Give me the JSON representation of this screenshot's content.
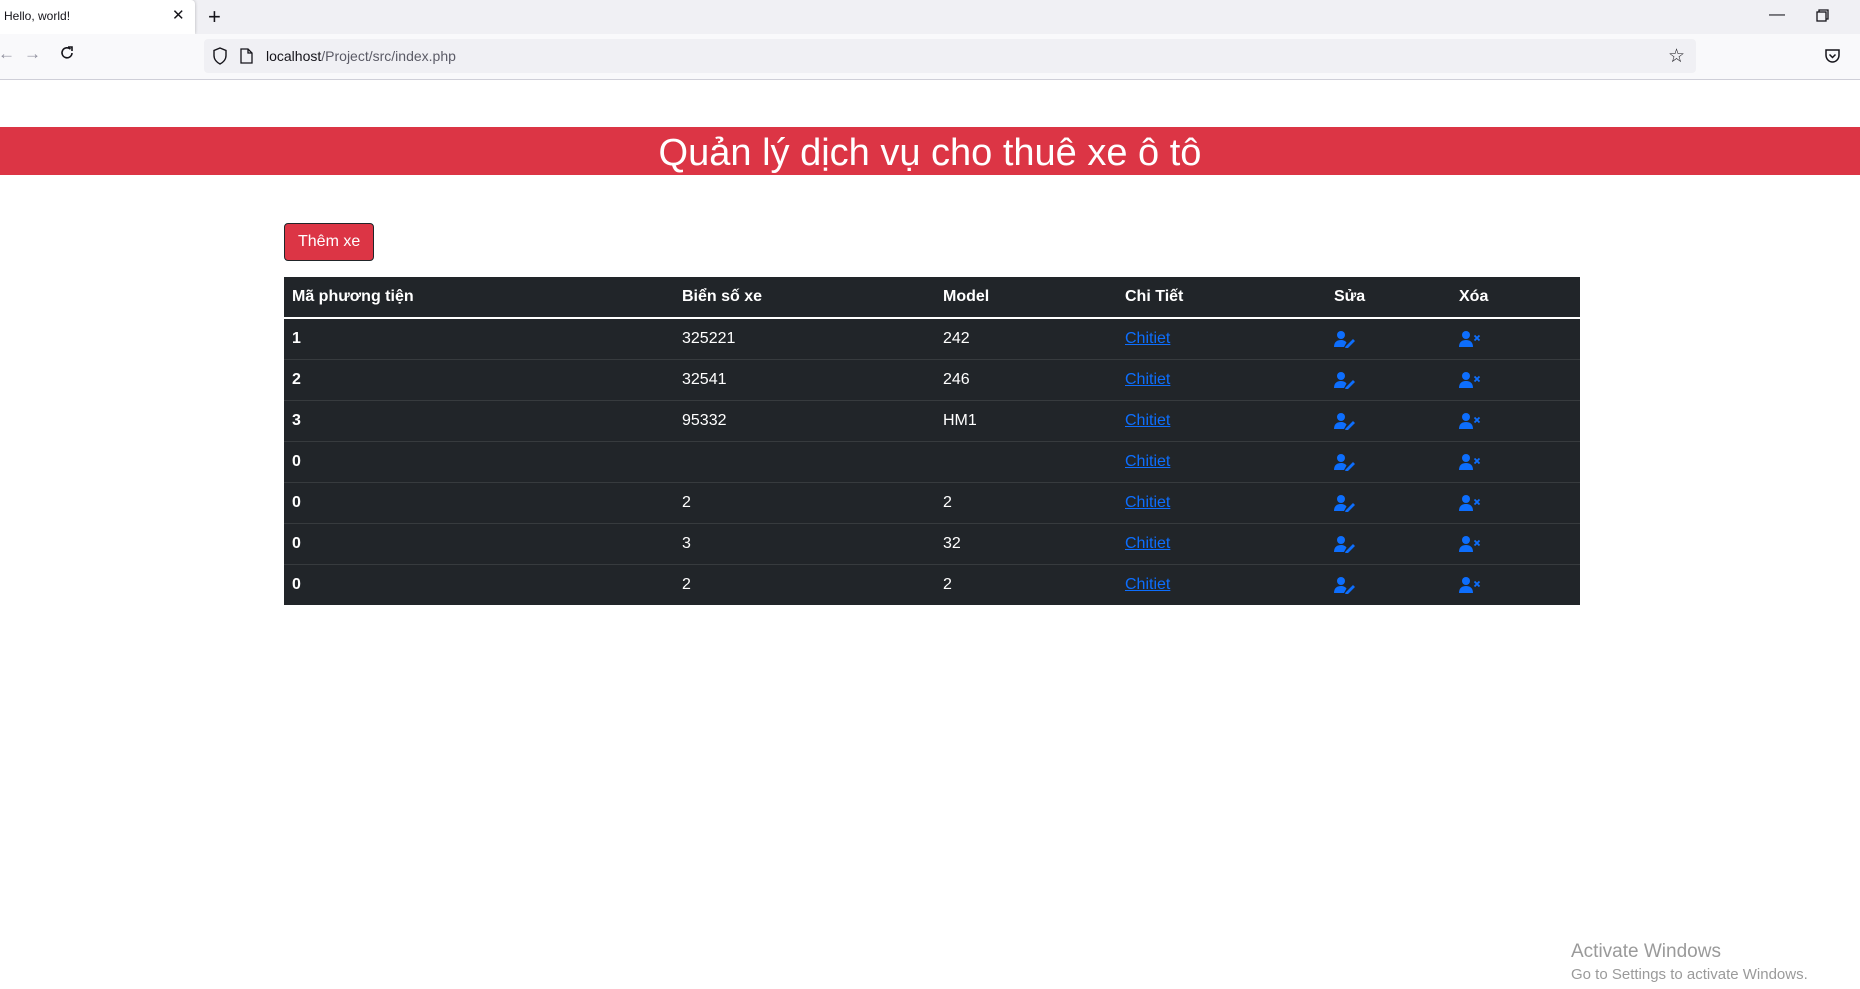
{
  "browser": {
    "tab_title": "Hello, world!",
    "url_host": "localhost",
    "url_path": "/Project/src/index.php"
  },
  "page": {
    "title": "Quản lý dịch vụ cho thuê xe ô tô",
    "add_button": "Thêm xe",
    "accent_color": "#dc3545",
    "link_color": "#0d6efd"
  },
  "table": {
    "headers": [
      "Mã phương tiện",
      "Biển số xe",
      "Model",
      "Chi Tiết",
      "Sửa",
      "Xóa"
    ],
    "rows": [
      {
        "id": "1",
        "plate": "325221",
        "model": "242",
        "detail": "Chitiet"
      },
      {
        "id": "2",
        "plate": "32541",
        "model": "246",
        "detail": "Chitiet"
      },
      {
        "id": "3",
        "plate": "95332",
        "model": "HM1",
        "detail": "Chitiet"
      },
      {
        "id": "0",
        "plate": "",
        "model": "",
        "detail": "Chitiet"
      },
      {
        "id": "0",
        "plate": "2",
        "model": "2",
        "detail": "Chitiet"
      },
      {
        "id": "0",
        "plate": "3",
        "model": "32",
        "detail": "Chitiet"
      },
      {
        "id": "0",
        "plate": "2",
        "model": "2",
        "detail": "Chitiet"
      }
    ],
    "edit_icon": "user-edit-icon",
    "delete_icon": "user-remove-icon"
  },
  "watermark": {
    "title": "Activate Windows",
    "subtitle": "Go to Settings to activate Windows."
  }
}
